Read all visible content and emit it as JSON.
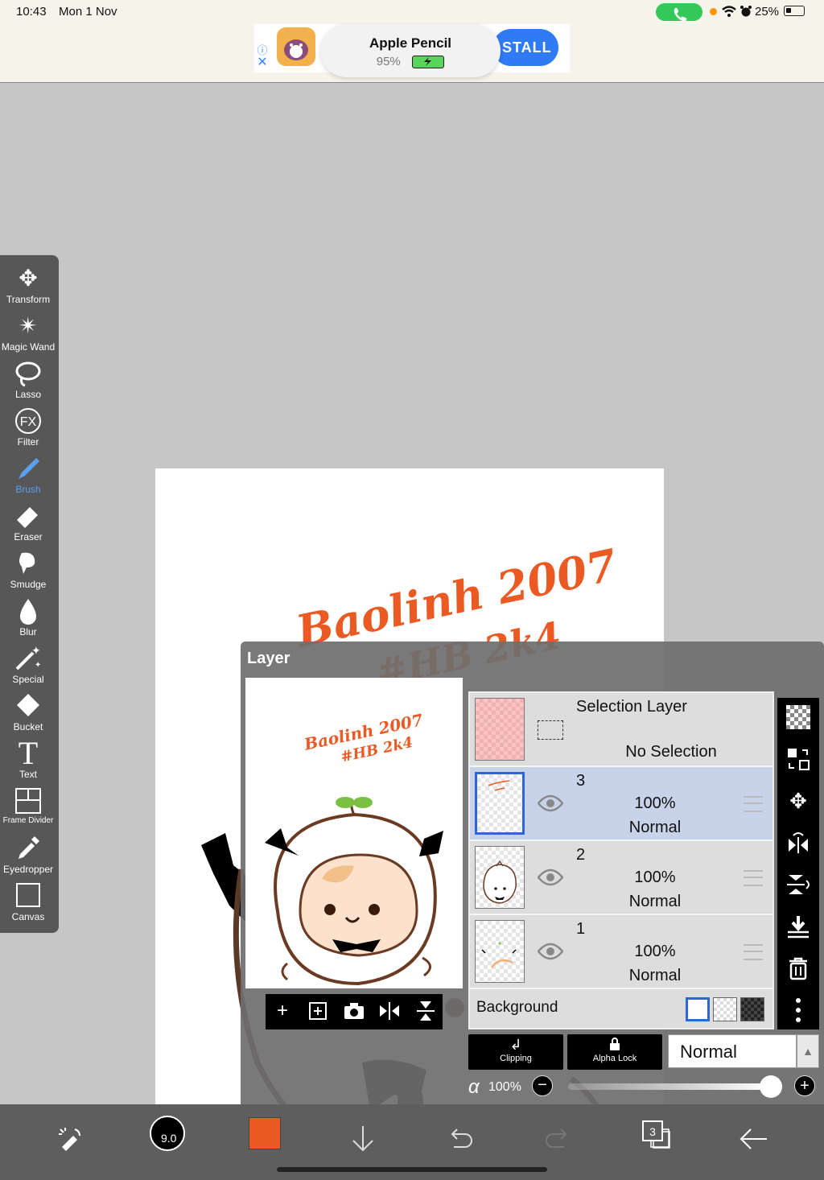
{
  "status": {
    "time": "10:43",
    "date": "Mon 1 Nov",
    "battery": "25%"
  },
  "ad": {
    "install_label": "STALL",
    "popup_title": "Apple Pencil",
    "popup_battery": "95%"
  },
  "toolbar": {
    "items": [
      {
        "label": "Transform",
        "icon": "move-icon"
      },
      {
        "label": "Magic Wand",
        "icon": "magic-wand-icon"
      },
      {
        "label": "Lasso",
        "icon": "lasso-icon"
      },
      {
        "label": "Filter",
        "icon": "fx-icon"
      },
      {
        "label": "Brush",
        "icon": "brush-icon"
      },
      {
        "label": "Eraser",
        "icon": "eraser-icon"
      },
      {
        "label": "Smudge",
        "icon": "smudge-icon"
      },
      {
        "label": "Blur",
        "icon": "drop-icon"
      },
      {
        "label": "Special",
        "icon": "sparkle-icon"
      },
      {
        "label": "Bucket",
        "icon": "bucket-icon"
      },
      {
        "label": "Text",
        "icon": "text-icon"
      },
      {
        "label": "Frame Divider",
        "icon": "frame-divider-icon"
      },
      {
        "label": "Eyedropper",
        "icon": "eyedropper-icon"
      },
      {
        "label": "Canvas",
        "icon": "canvas-icon"
      }
    ],
    "active": "Brush"
  },
  "layer_panel": {
    "title": "Layer",
    "selection_layer": {
      "title": "Selection Layer",
      "status": "No Selection"
    },
    "layers": [
      {
        "name": "3",
        "opacity": "100%",
        "mode": "Normal"
      },
      {
        "name": "2",
        "opacity": "100%",
        "mode": "Normal"
      },
      {
        "name": "1",
        "opacity": "100%",
        "mode": "Normal"
      }
    ],
    "background_label": "Background",
    "clipping_label": "Clipping",
    "alpha_lock_label": "Alpha Lock",
    "blend_mode": "Normal",
    "alpha_symbol": "α",
    "alpha_value": "100%"
  },
  "bottombar": {
    "brush_size": "9.0",
    "layer_count": "3",
    "color": "#ec5a24"
  },
  "canvas_text": {
    "line1": "Baolinh 2007",
    "line2": "#HB 2k4"
  }
}
